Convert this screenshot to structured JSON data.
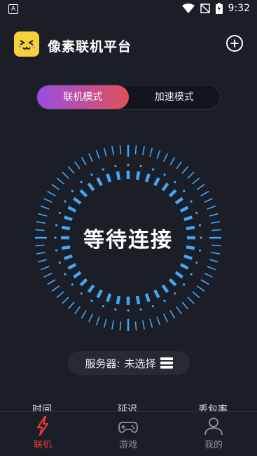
{
  "status_bar": {
    "left_badge": "A",
    "time": "9:32"
  },
  "header": {
    "app_title": "像素联机平台"
  },
  "mode_switch": {
    "tabs": [
      {
        "label": "联机模式",
        "active": true
      },
      {
        "label": "加速模式",
        "active": false
      }
    ]
  },
  "dial": {
    "status_text": "等待连接",
    "accent_color": "#42a5f5"
  },
  "server": {
    "label": "服务器:",
    "value": "未选择"
  },
  "stats": {
    "labels": [
      "时间",
      "延迟",
      "丢包率"
    ]
  },
  "bottom_nav": {
    "items": [
      {
        "label": "联机",
        "icon": "lightning-icon",
        "active": true
      },
      {
        "label": "游戏",
        "icon": "gamepad-icon",
        "active": false
      },
      {
        "label": "我的",
        "icon": "user-icon",
        "active": false
      }
    ]
  },
  "colors": {
    "background": "#1b1e26",
    "accent_red": "#e53935",
    "logo_yellow": "#f6d23a"
  }
}
